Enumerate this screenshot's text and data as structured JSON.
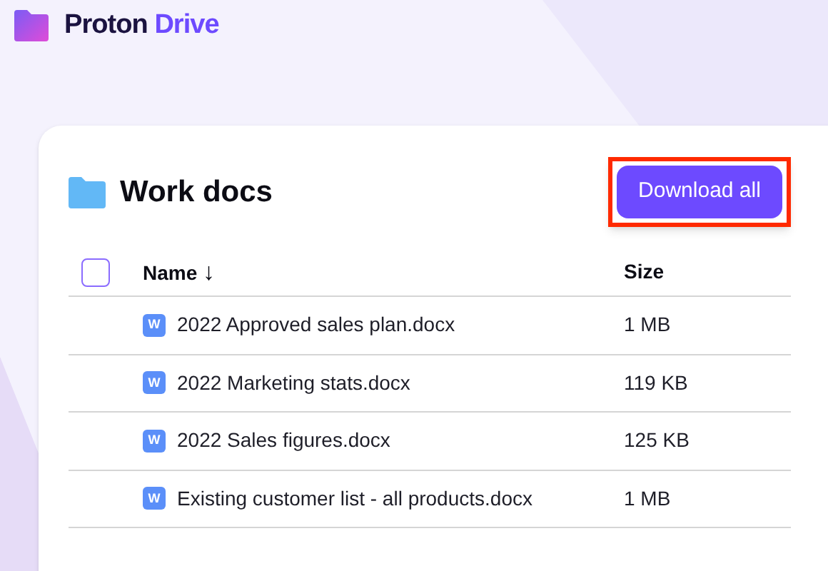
{
  "brand": {
    "name": "Proton",
    "product": "Drive"
  },
  "folder": {
    "title": "Work docs"
  },
  "download_button": {
    "label": "Download all",
    "highlighted": true
  },
  "table": {
    "select_all": {
      "checked": false
    },
    "columns": [
      {
        "label": "Name",
        "sort": "↓"
      },
      {
        "label": "Size"
      }
    ],
    "rows": [
      {
        "icon_letter": "W",
        "name": "2022 Approved sales plan.docx",
        "size": "1 MB"
      },
      {
        "icon_letter": "W",
        "name": "2022 Marketing stats.docx",
        "size": "119 KB"
      },
      {
        "icon_letter": "W",
        "name": "2022 Sales figures.docx",
        "size": "125 KB"
      },
      {
        "icon_letter": "W",
        "name": "Existing customer list - all products.docx",
        "size": "1 MB"
      }
    ]
  }
}
